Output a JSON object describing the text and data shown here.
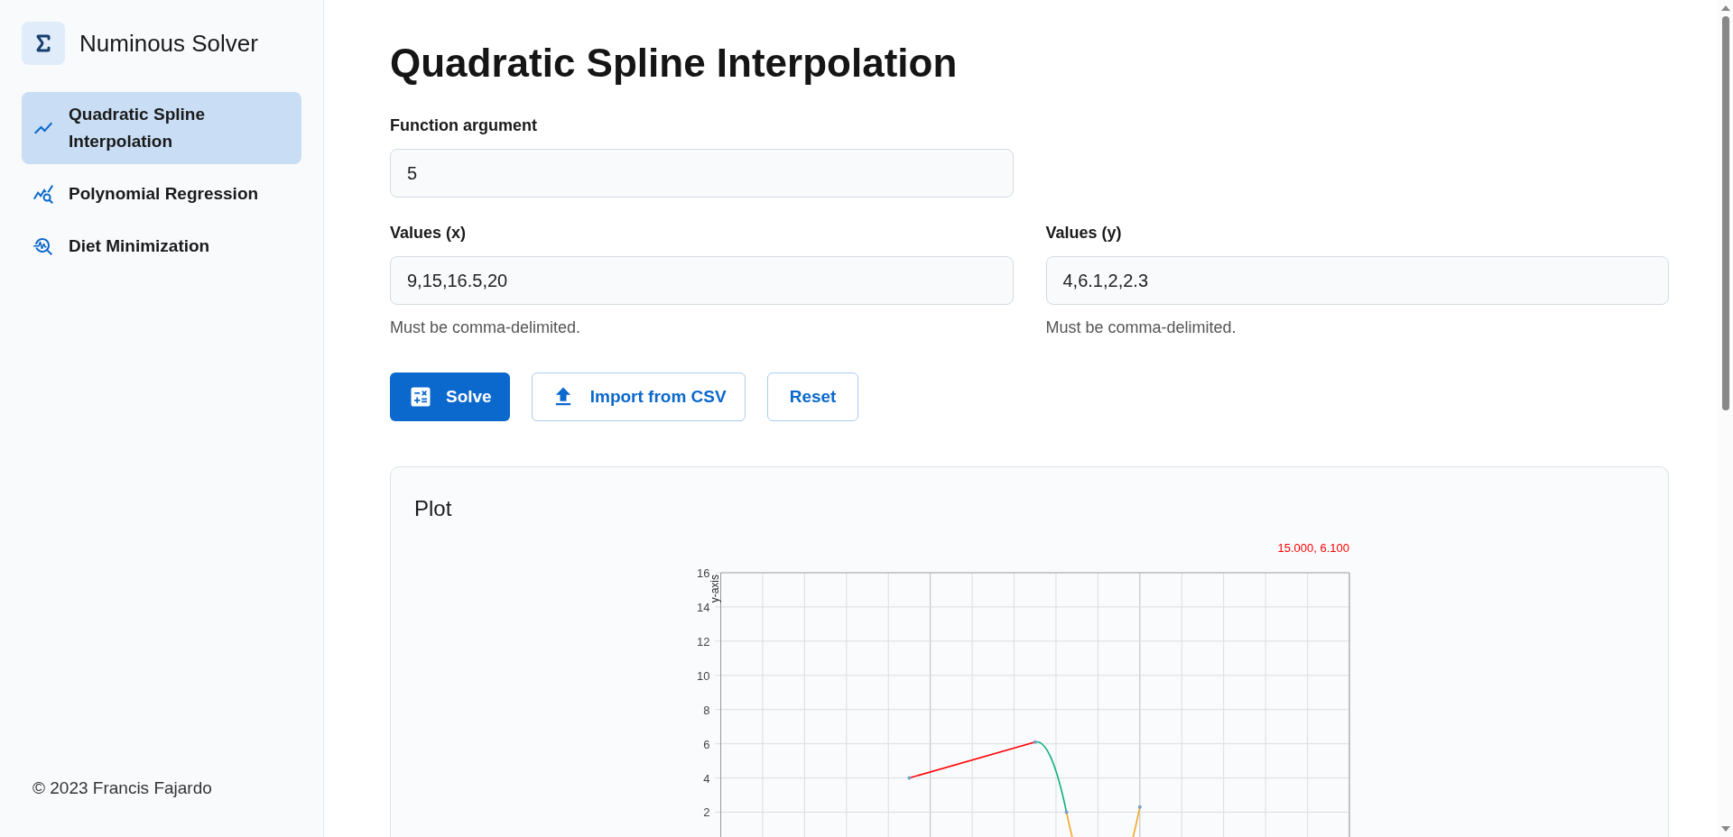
{
  "sidebar": {
    "app_title": "Numinous Solver",
    "items": [
      {
        "label": "Quadratic Spline Interpolation",
        "selected": true
      },
      {
        "label": "Polynomial Regression",
        "selected": false
      },
      {
        "label": "Diet Minimization",
        "selected": false
      }
    ],
    "footer": "© 2023 Francis Fajardo"
  },
  "page": {
    "title": "Quadratic Spline Interpolation",
    "argument": {
      "label": "Function argument",
      "value": "5"
    },
    "values_x": {
      "label": "Values (x)",
      "value": "9,15,16.5,20",
      "hint": "Must be comma-delimited."
    },
    "values_y": {
      "label": "Values (y)",
      "value": "4,6.1,2,2.3",
      "hint": "Must be comma-delimited."
    },
    "buttons": [
      {
        "label": "Solve",
        "kind": "primary"
      },
      {
        "label": "Import from CSV",
        "kind": "upload"
      },
      {
        "label": "Reset",
        "kind": "plain"
      }
    ],
    "plot": {
      "title": "Plot",
      "readout": "15.000, 6.100",
      "y_axis": {
        "label": "y-axis",
        "ticks": [
          "16",
          "14",
          "12",
          "10",
          "8",
          "6",
          "4",
          "2"
        ]
      }
    }
  }
}
